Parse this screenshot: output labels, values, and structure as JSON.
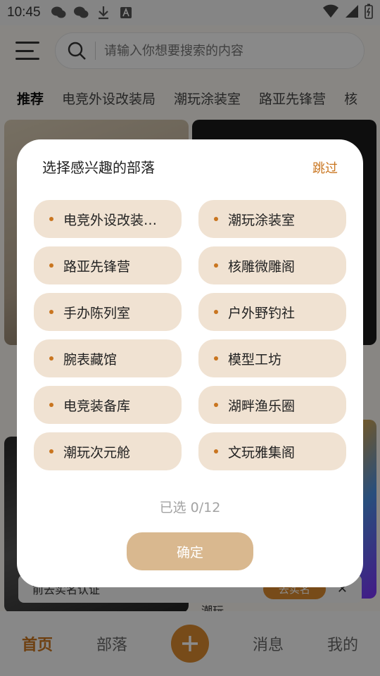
{
  "status_bar": {
    "time": "10:45"
  },
  "search": {
    "placeholder": "请输入你想要搜索的内容"
  },
  "tabs": [
    "推荐",
    "电竞外设改装局",
    "潮玩涂装室",
    "路亚先锋营",
    "核"
  ],
  "bottom_nav": {
    "home": "首页",
    "tribe": "部落",
    "messages": "消息",
    "mine": "我的"
  },
  "background_text": {
    "verify_banner": "前去实名认证",
    "verify_button": "去实名",
    "post_tag": "潮玩"
  },
  "dialog": {
    "title": "选择感兴趣的部落",
    "skip": "跳过",
    "tribes": [
      "电竞外设改装…",
      "潮玩涂装室",
      "路亚先锋营",
      "核雕微雕阁",
      "手办陈列室",
      "户外野钓社",
      "腕表藏馆",
      "模型工坊",
      "电竞装备库",
      "湖畔渔乐圈",
      "潮玩次元舱",
      "文玩雅集阁"
    ],
    "selected_count": "已选 0/12",
    "confirm": "确定"
  },
  "colors": {
    "accent": "#c9751f",
    "chip_bg": "#f0e2d2",
    "confirm_bg": "#d9b88f"
  }
}
